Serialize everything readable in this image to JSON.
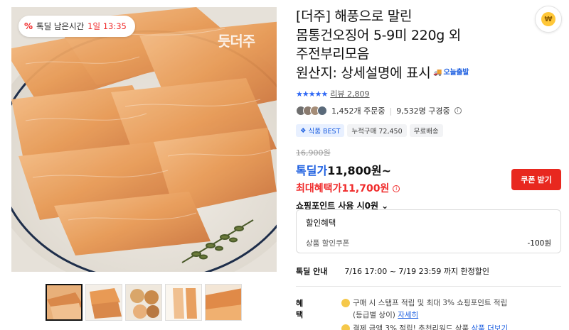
{
  "hero": {
    "timer_icon": "percent-icon",
    "timer_label": "톡딜 남은시간",
    "timer_value": "1일 13:35",
    "brand_watermark": "듯더주"
  },
  "thumbnails": [
    "thumb-1",
    "thumb-2",
    "thumb-3",
    "thumb-4",
    "thumb-5"
  ],
  "product": {
    "title_lines": [
      "[더주] 해풍으로 말린",
      "몸통건오징어 5-9미 220g 외",
      "주전부리모음",
      "원산지: 상세설명에 표시"
    ],
    "delivery_badge": "오늘출발",
    "rating_stars": "★★★★★",
    "review_label": "리뷰 2,809",
    "orders": "1,452개 주문중",
    "views": "9,532명 구경중",
    "tags": [
      "식품 BEST",
      "누적구매 72,450",
      "무료배송"
    ],
    "original_price": "16,900원",
    "deal_label": "톡딜가",
    "deal_price": "11,800원~",
    "max_benefit_label": "최대혜택가",
    "max_benefit_price": "11,700원",
    "points_label": "쇼핑포인트 사용 시0원"
  },
  "coupon_button": "쿠폰 받기",
  "discount": {
    "header": "할인혜택",
    "row_label": "상품 할인쿠폰",
    "row_value": "-100원"
  },
  "deal_info": {
    "label": "톡딜 안내",
    "value": "7/16 17:00 ~ 7/19 23:59 까지 한정할인"
  },
  "benefits": {
    "label": "혜택",
    "line1": "구매 시 스탬프 적립 및 최대 3% 쇼핑포인트 적립",
    "line2": "(등급별 상이)",
    "link": "자세히",
    "line3": "결제 금액 3% 적립! 추천리워드 상품",
    "line3_link": "상품 더보기"
  },
  "colors": {
    "accent_blue": "#1d5fe0",
    "accent_red": "#f02b2b",
    "coupon_red": "#e8281f"
  }
}
